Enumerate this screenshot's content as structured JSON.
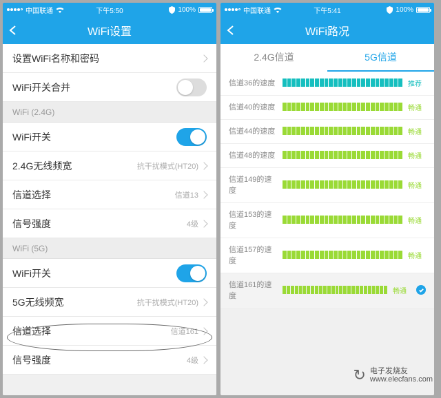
{
  "left": {
    "status": {
      "carrier": "中国联通",
      "time": "下午5:50",
      "battery": "100%"
    },
    "title": "WiFi设置",
    "rows": {
      "name_pwd": "设置WiFi名称和密码",
      "merge": "WiFi开关合并",
      "section24": "WiFi (2.4G)",
      "switch": "WiFi开关",
      "bw24_label": "2.4G无线频宽",
      "bw24_value": "抗干扰模式(HT20)",
      "channel_label": "信道选择",
      "channel24_value": "信道13",
      "strength_label": "信号强度",
      "strength_value": "4级",
      "section5": "WiFi (5G)",
      "bw5_label": "5G无线频宽",
      "bw5_value": "抗干扰模式(HT20)",
      "channel5_value": "信道161"
    }
  },
  "right": {
    "status": {
      "carrier": "中国联通",
      "time": "下午5:41",
      "battery": "100%"
    },
    "title": "WiFi路况",
    "tabs": {
      "tab24": "2.4G信道",
      "tab5": "5G信道"
    },
    "status_labels": {
      "recommended": "推荐",
      "smooth": "畅通"
    },
    "channels": [
      {
        "label": "信道36的速度",
        "status": "recommended",
        "color": "teal",
        "selected": false
      },
      {
        "label": "信道40的速度",
        "status": "smooth",
        "color": "green",
        "selected": false
      },
      {
        "label": "信道44的速度",
        "status": "smooth",
        "color": "green",
        "selected": false
      },
      {
        "label": "信道48的速度",
        "status": "smooth",
        "color": "green",
        "selected": false
      },
      {
        "label": "信道149的速度",
        "status": "smooth",
        "color": "green",
        "selected": false
      },
      {
        "label": "信道153的速度",
        "status": "smooth",
        "color": "green",
        "selected": false
      },
      {
        "label": "信道157的速度",
        "status": "smooth",
        "color": "green",
        "selected": false
      },
      {
        "label": "信道161的速度",
        "status": "smooth",
        "color": "green",
        "selected": true
      }
    ]
  },
  "watermark": {
    "brand": "电子发烧友",
    "url": "www.elecfans.com"
  }
}
